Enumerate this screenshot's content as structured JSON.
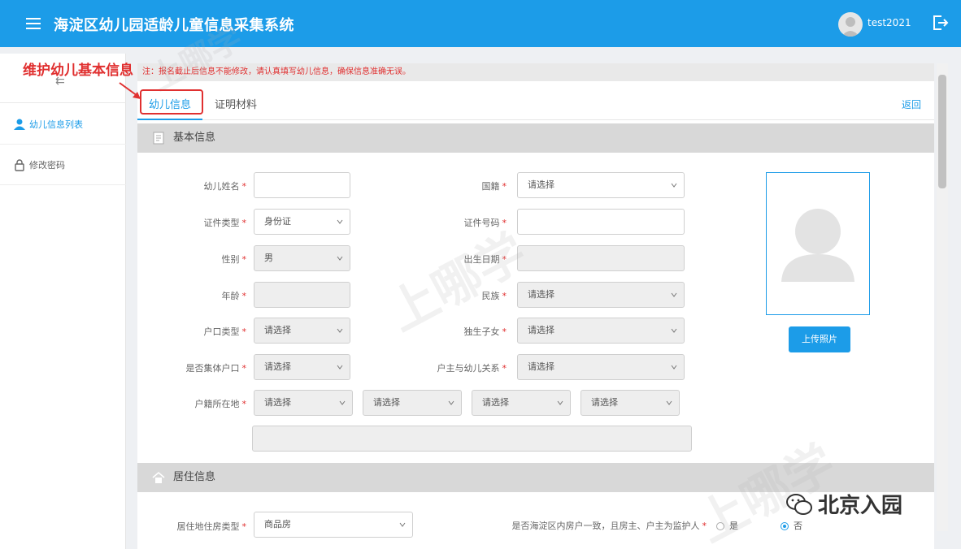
{
  "header": {
    "title": "海淀区幼儿园适龄儿童信息采集系统",
    "username": "test2021"
  },
  "annotation": {
    "text": "维护幼儿基本信息"
  },
  "sidebar": {
    "collapse_icon": "⇇",
    "items": [
      {
        "label": "幼儿信息列表",
        "icon": "child-icon",
        "active": true
      },
      {
        "label": "修改密码",
        "icon": "lock-icon",
        "active": false
      }
    ]
  },
  "notice": "注：报名截止后信息不能修改，请认真填写幼儿信息，确保信息准确无误。",
  "tabs": [
    {
      "label": "幼儿信息",
      "active": true
    },
    {
      "label": "证明材料",
      "active": false
    }
  ],
  "back_label": "返回",
  "sections": {
    "basic": "基本信息",
    "residence": "居住信息"
  },
  "form": {
    "name": {
      "label": "幼儿姓名",
      "value": ""
    },
    "nationality": {
      "label": "国籍",
      "value": "请选择"
    },
    "id_type": {
      "label": "证件类型",
      "value": "身份证"
    },
    "id_number": {
      "label": "证件号码",
      "value": ""
    },
    "gender": {
      "label": "性别",
      "value": "男"
    },
    "birthdate": {
      "label": "出生日期",
      "value": ""
    },
    "age": {
      "label": "年龄",
      "value": ""
    },
    "ethnicity": {
      "label": "民族",
      "value": "请选择"
    },
    "hukou_type": {
      "label": "户口类型",
      "value": "请选择"
    },
    "only_child": {
      "label": "独生子女",
      "value": "请选择"
    },
    "collective_hukou": {
      "label": "是否集体户口",
      "value": "请选择"
    },
    "relation": {
      "label": "户主与幼儿关系",
      "value": "请选择"
    },
    "hukou_location": {
      "label": "户籍所在地",
      "values": [
        "请选择",
        "请选择",
        "请选择",
        "请选择"
      ]
    },
    "address_detail": {
      "value": ""
    },
    "housing_type": {
      "label": "居住地住房类型",
      "value": "商品房"
    },
    "same_household": {
      "label": "是否海淀区内房户一致，且房主、户主为监护人",
      "options": [
        "是",
        "否"
      ],
      "selected": "否"
    }
  },
  "photo": {
    "upload_label": "上传照片"
  },
  "watermarks": {
    "text": "上哪学",
    "brand": "北京入园"
  },
  "colors": {
    "primary": "#1c9ce8",
    "annotation": "#e03030",
    "section_bg": "#d8d8d8"
  }
}
